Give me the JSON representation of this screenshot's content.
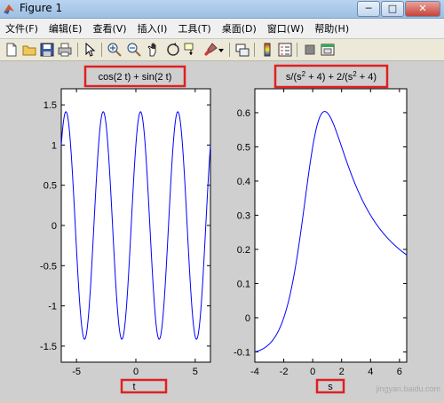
{
  "window": {
    "title": "Figure 1",
    "minimize": "─",
    "maximize": "□",
    "close": "✕"
  },
  "menu": [
    "文件(F)",
    "编辑(E)",
    "查看(V)",
    "插入(I)",
    "工具(T)",
    "桌面(D)",
    "窗口(W)",
    "帮助(H)"
  ],
  "toolbar_icons": [
    "new-file-icon",
    "open-folder-icon",
    "save-icon",
    "print-icon",
    "arrow-pointer-icon",
    "zoom-in-icon",
    "zoom-out-icon",
    "pan-hand-icon",
    "rotate-3d-icon",
    "data-cursor-icon",
    "brush-icon",
    "dropdown-arrow-icon",
    "link-plot-icon",
    "colorbar-icon",
    "legend-icon",
    "hide-plot-tools-icon",
    "show-plot-tools-icon"
  ],
  "watermark": "jingyan.baidu.com",
  "chart_data": [
    {
      "type": "line",
      "title": "cos(2 t) + sin(2 t)",
      "xlabel": "t",
      "ylabel": "",
      "xlim": [
        -6.2832,
        6.2832
      ],
      "ylim": [
        -1.7,
        1.7
      ],
      "xticks": [
        -5,
        0,
        5
      ],
      "yticks": [
        -1.5,
        -1,
        -0.5,
        0,
        0.5,
        1,
        1.5
      ],
      "xtick_labels": [
        "-5",
        "0",
        "5"
      ],
      "ytick_labels": [
        "-1.5",
        "-1",
        "-0.5",
        "0",
        "0.5",
        "1",
        "1.5"
      ],
      "series": [
        {
          "color": "#0000ff",
          "function": "cos(2*t)+sin(2*t)"
        }
      ],
      "grid": false
    },
    {
      "type": "line",
      "title": "s/(s² + 4) + 2/(s² + 4)",
      "title_parts": [
        "s/(s",
        "2",
        " + 4) + 2/(s",
        "2",
        " + 4)"
      ],
      "xlabel": "s",
      "ylabel": "",
      "xlim": [
        -4,
        6.5
      ],
      "ylim": [
        -0.13,
        0.67
      ],
      "xticks": [
        -4,
        -2,
        0,
        2,
        4,
        6
      ],
      "yticks": [
        -0.1,
        0,
        0.1,
        0.2,
        0.3,
        0.4,
        0.5,
        0.6
      ],
      "xtick_labels": [
        "-4",
        "-2",
        "0",
        "2",
        "4",
        "6"
      ],
      "ytick_labels": [
        "-0.1",
        "0",
        "0.1",
        "0.2",
        "0.3",
        "0.4",
        "0.5",
        "0.6"
      ],
      "series": [
        {
          "color": "#0000ff",
          "function": "(s+2)/(s*s+4)"
        }
      ],
      "grid": false
    }
  ],
  "colors": {
    "highlight": "#e02020",
    "plot_line": "#0000ff",
    "figure_bg": "#cfcfcf"
  }
}
